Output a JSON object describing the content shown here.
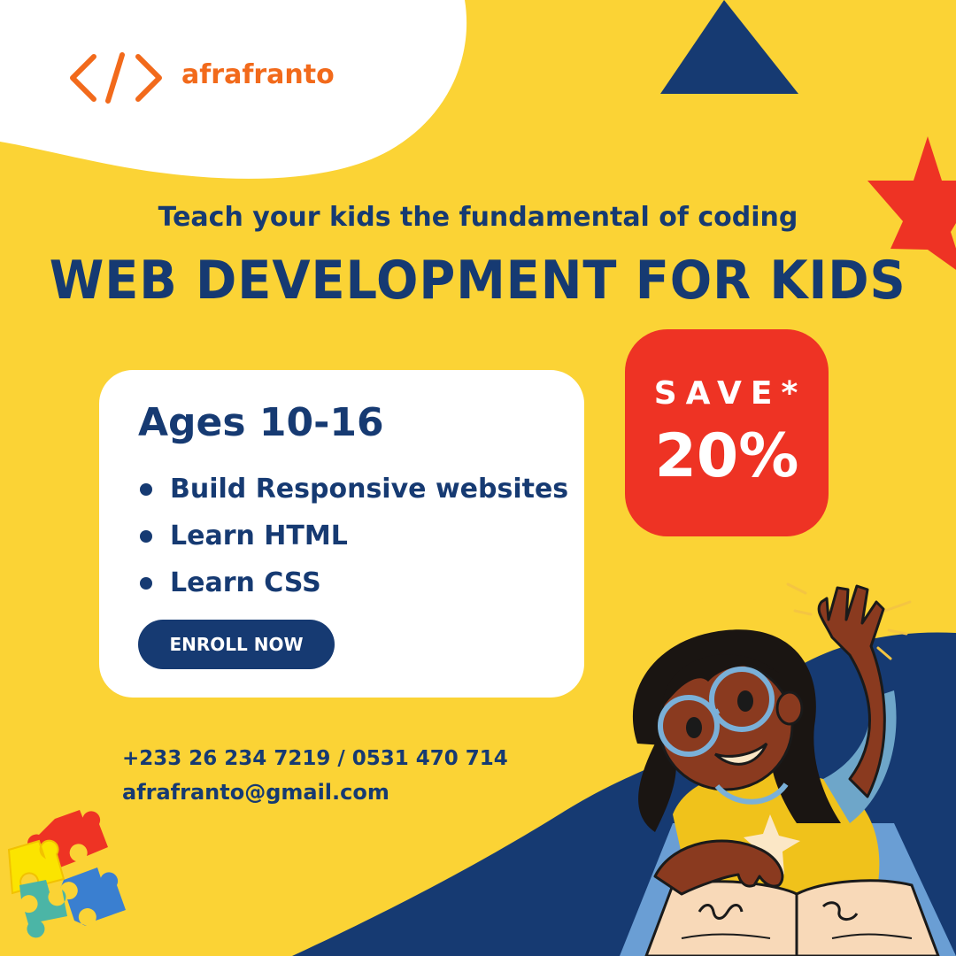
{
  "brand": {
    "name": "afrafranto",
    "logo_icon": "code-brackets-icon",
    "color": "#f26a1b"
  },
  "hero": {
    "tagline": "Teach your kids the fundamental of coding",
    "headline": "WEB DEVELOPMENT FOR KIDS"
  },
  "card": {
    "ages": "Ages 10-16",
    "features": [
      "Build Responsive websites",
      "Learn HTML",
      "Learn CSS"
    ],
    "cta_label": "ENROLL NOW"
  },
  "promo": {
    "label": "SAVE*",
    "value": "20%"
  },
  "contact": {
    "phone": "+233 26 234 7219 / 0531 470 714",
    "email": "afrafranto@gmail.com"
  },
  "colors": {
    "background": "#fbd335",
    "navy": "#163a72",
    "red": "#ee3324",
    "white": "#ffffff",
    "orange": "#f26a1b"
  },
  "decorations": [
    "triangle-shape",
    "star-shape",
    "puzzle-pieces-icon",
    "kid-reading-illustration"
  ]
}
